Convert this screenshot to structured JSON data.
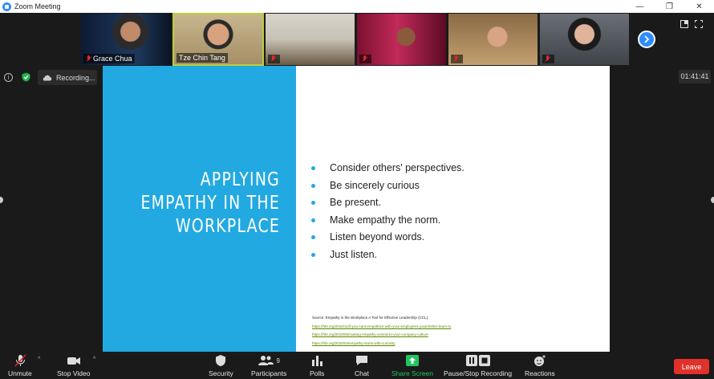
{
  "window": {
    "title": "Zoom Meeting"
  },
  "participants": [
    {
      "name": "Grace Chua",
      "muted": true
    },
    {
      "name": "Tze Chin Tang",
      "muted": false
    },
    {
      "name": "",
      "muted": true
    },
    {
      "name": "",
      "muted": true
    },
    {
      "name": "",
      "muted": true
    },
    {
      "name": "",
      "muted": true
    }
  ],
  "recording": {
    "status_label": "Recording..."
  },
  "meeting": {
    "elapsed": "01:41:41"
  },
  "slide": {
    "title_line1": "APPLYING",
    "title_line2": "EMPATHY IN THE",
    "title_line3": "WORKPLACE",
    "bullets": [
      "Consider others' perspectives.",
      "Be sincerely curious",
      "Be present.",
      "Make empathy the norm.",
      "Listen beyond words.",
      "Just listen."
    ],
    "source_title": "Source: Empathy in the Workplace A Tool for Effective Leadership (CCL),",
    "source_links": [
      "https://hbr.org/2016/11/if-you-cant-empathize-with-your-employees-youd-better-learn-to",
      "https://hbr.org/2019/05/making-empathy-central-to-your-company-culture",
      "https://hbr.org/2020/04/empathy-starts-with-curiosity"
    ],
    "accent_color": "#23a9e1"
  },
  "toolbar": {
    "unmute": "Unmute",
    "stop_video": "Stop Video",
    "security": "Security",
    "participants": "Participants",
    "participant_count": "9",
    "polls": "Polls",
    "chat": "Chat",
    "share_screen": "Share Screen",
    "pause_recording": "Pause/Stop Recording",
    "reactions": "Reactions",
    "leave": "Leave"
  },
  "colors": {
    "leave": "#e0312a",
    "share": "#22c55e",
    "brand": "#2d8cff"
  }
}
